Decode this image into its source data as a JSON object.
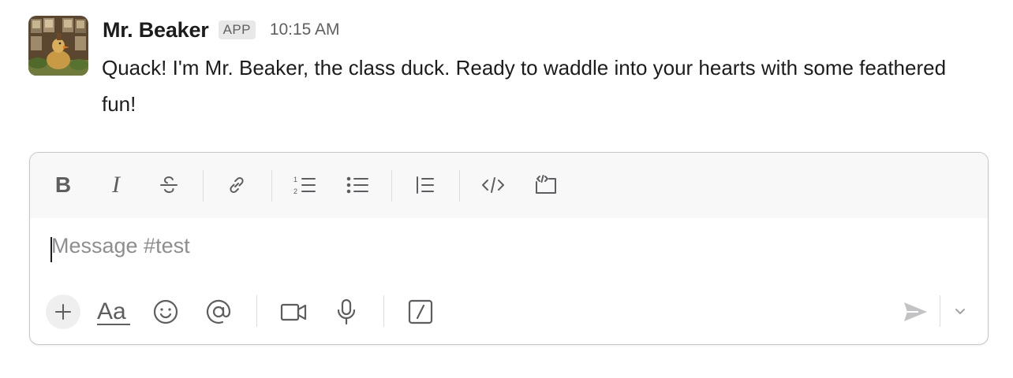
{
  "message": {
    "sender": "Mr. Beaker",
    "badge": "APP",
    "time": "10:15 AM",
    "text": "Quack! I'm Mr. Beaker, the class duck. Ready to waddle into your hearts with some feathered fun!",
    "avatar_icon": "duck-avatar"
  },
  "composer": {
    "placeholder": "Message #test",
    "formatting_toolbar": [
      {
        "name": "bold",
        "icon": "bold-icon"
      },
      {
        "name": "italic",
        "icon": "italic-icon"
      },
      {
        "name": "strikethrough",
        "icon": "strikethrough-icon"
      },
      {
        "name": "link",
        "icon": "link-icon"
      },
      {
        "name": "ordered-list",
        "icon": "ordered-list-icon"
      },
      {
        "name": "bulleted-list",
        "icon": "bulleted-list-icon"
      },
      {
        "name": "blockquote",
        "icon": "blockquote-icon"
      },
      {
        "name": "code",
        "icon": "code-icon"
      },
      {
        "name": "code-block",
        "icon": "code-block-icon"
      }
    ],
    "actions": [
      {
        "name": "attach",
        "icon": "plus-icon"
      },
      {
        "name": "formatting",
        "icon": "text-format-icon",
        "label": "Aa"
      },
      {
        "name": "emoji",
        "icon": "emoji-icon"
      },
      {
        "name": "mention",
        "icon": "at-sign-icon"
      },
      {
        "name": "video",
        "icon": "video-icon"
      },
      {
        "name": "audio",
        "icon": "microphone-icon"
      },
      {
        "name": "shortcuts",
        "icon": "slash-command-icon"
      },
      {
        "name": "send",
        "icon": "send-icon"
      },
      {
        "name": "send-options",
        "icon": "chevron-down-icon"
      }
    ]
  },
  "colors": {
    "text": "#1d1c1d",
    "muted": "#616061",
    "placeholder": "#8e8d8f",
    "border": "#c7c7c9",
    "toolbar_bg": "#f8f8f8"
  }
}
